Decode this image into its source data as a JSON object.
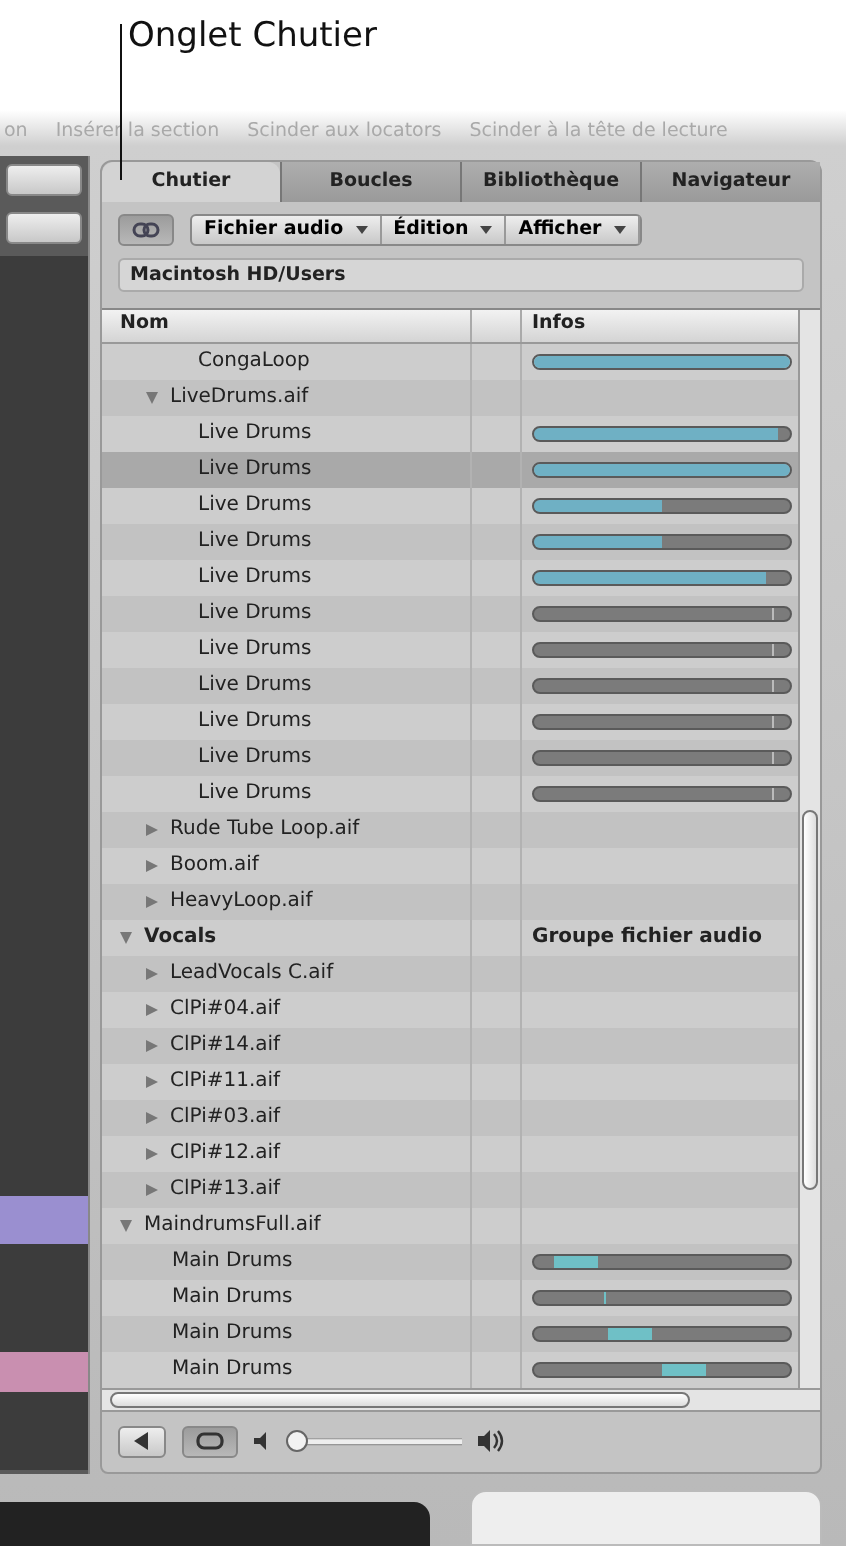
{
  "callout": "Onglet Chutier",
  "menu_items": [
    "on",
    "Insérer la section",
    "Scinder aux locators",
    "Scinder à la tête de lecture"
  ],
  "tabs": [
    {
      "label": "Chutier",
      "selected": true
    },
    {
      "label": "Boucles",
      "selected": false
    },
    {
      "label": "Bibliothèque",
      "selected": false
    },
    {
      "label": "Navigateur",
      "selected": false
    }
  ],
  "toolbar": {
    "link_button": {
      "on": true
    },
    "menus": [
      "Fichier audio",
      "Édition",
      "Afficher"
    ]
  },
  "path": "Macintosh HD/Users",
  "columns": [
    "Nom",
    "Infos"
  ],
  "tree": [
    {
      "kind": "partial",
      "children": [
        {
          "kind": "partial",
          "children": [
            {
              "name": "CongaLoop",
              "kind": "region",
              "selected": false,
              "bar": {
                "kind": "fill",
                "level": 1.0
              }
            }
          ]
        },
        {
          "name": "LiveDrums.aif",
          "kind": "file",
          "expanded": true,
          "selected": false,
          "children": [
            {
              "name": "Live Drums",
              "kind": "region",
              "selected": false,
              "bar": {
                "kind": "fill",
                "level": 0.95
              }
            },
            {
              "name": "Live Drums",
              "kind": "region",
              "selected": true,
              "bar": {
                "kind": "fill",
                "level": 1.0
              }
            },
            {
              "name": "Live Drums",
              "kind": "region",
              "selected": false,
              "bar": {
                "kind": "fill",
                "level": 0.5
              }
            },
            {
              "name": "Live Drums",
              "kind": "region",
              "selected": false,
              "bar": {
                "kind": "fill",
                "level": 0.5
              }
            },
            {
              "name": "Live Drums",
              "kind": "region",
              "selected": false,
              "bar": {
                "kind": "fill",
                "level": 0.91
              }
            },
            {
              "name": "Live Drums",
              "kind": "region",
              "selected": false,
              "bar": {
                "kind": "empty"
              }
            },
            {
              "name": "Live Drums",
              "kind": "region",
              "selected": false,
              "bar": {
                "kind": "empty"
              }
            },
            {
              "name": "Live Drums",
              "kind": "region",
              "selected": false,
              "bar": {
                "kind": "empty"
              }
            },
            {
              "name": "Live Drums",
              "kind": "region",
              "selected": false,
              "bar": {
                "kind": "empty"
              }
            },
            {
              "name": "Live Drums",
              "kind": "region",
              "selected": false,
              "bar": {
                "kind": "empty"
              }
            },
            {
              "name": "Live Drums",
              "kind": "region",
              "selected": false,
              "bar": {
                "kind": "empty"
              }
            }
          ]
        },
        {
          "name": "Rude Tube Loop.aif",
          "kind": "file",
          "expanded": false,
          "selected": false
        },
        {
          "name": "Boom.aif",
          "kind": "file",
          "expanded": false,
          "selected": false
        },
        {
          "name": "HeavyLoop.aif",
          "kind": "file",
          "expanded": false,
          "selected": false
        }
      ]
    },
    {
      "name": "Vocals",
      "kind": "group",
      "expanded": true,
      "selected": false,
      "info": "Groupe fichier audio",
      "children": [
        {
          "name": "LeadVocals C.aif",
          "kind": "file",
          "expanded": false,
          "selected": false
        },
        {
          "name": "ClPi#04.aif",
          "kind": "file",
          "expanded": false,
          "selected": false
        },
        {
          "name": "ClPi#14.aif",
          "kind": "file",
          "expanded": false,
          "selected": false
        },
        {
          "name": "ClPi#11.aif",
          "kind": "file",
          "expanded": false,
          "selected": false
        },
        {
          "name": "ClPi#03.aif",
          "kind": "file",
          "expanded": false,
          "selected": false
        },
        {
          "name": "ClPi#12.aif",
          "kind": "file",
          "expanded": false,
          "selected": false
        },
        {
          "name": "ClPi#13.aif",
          "kind": "file",
          "expanded": false,
          "selected": false
        }
      ]
    },
    {
      "name": "MaindrumsFull.aif",
      "kind": "file",
      "expanded": true,
      "selected": false,
      "children": [
        {
          "name": "Main Drums",
          "kind": "region",
          "selected": false,
          "bar": {
            "kind": "segment",
            "start": {
              "level": 0.08
            },
            "end": {
              "level": 0.25
            }
          }
        },
        {
          "name": "Main Drums",
          "kind": "region",
          "selected": false,
          "bar": {
            "kind": "segment",
            "start": {
              "level": 0.27
            },
            "end": {
              "level": 0.285
            }
          }
        },
        {
          "name": "Main Drums",
          "kind": "region",
          "selected": false,
          "bar": {
            "kind": "segment",
            "start": {
              "level": 0.29
            },
            "end": {
              "level": 0.46
            }
          }
        },
        {
          "name": "Main Drums",
          "kind": "region",
          "selected": false,
          "bar": {
            "kind": "segment",
            "start": {
              "level": 0.5
            },
            "end": {
              "level": 0.67
            }
          }
        }
      ]
    }
  ],
  "playback": {
    "loop": {
      "on": true
    },
    "volume": {
      "level": 0.03
    }
  }
}
